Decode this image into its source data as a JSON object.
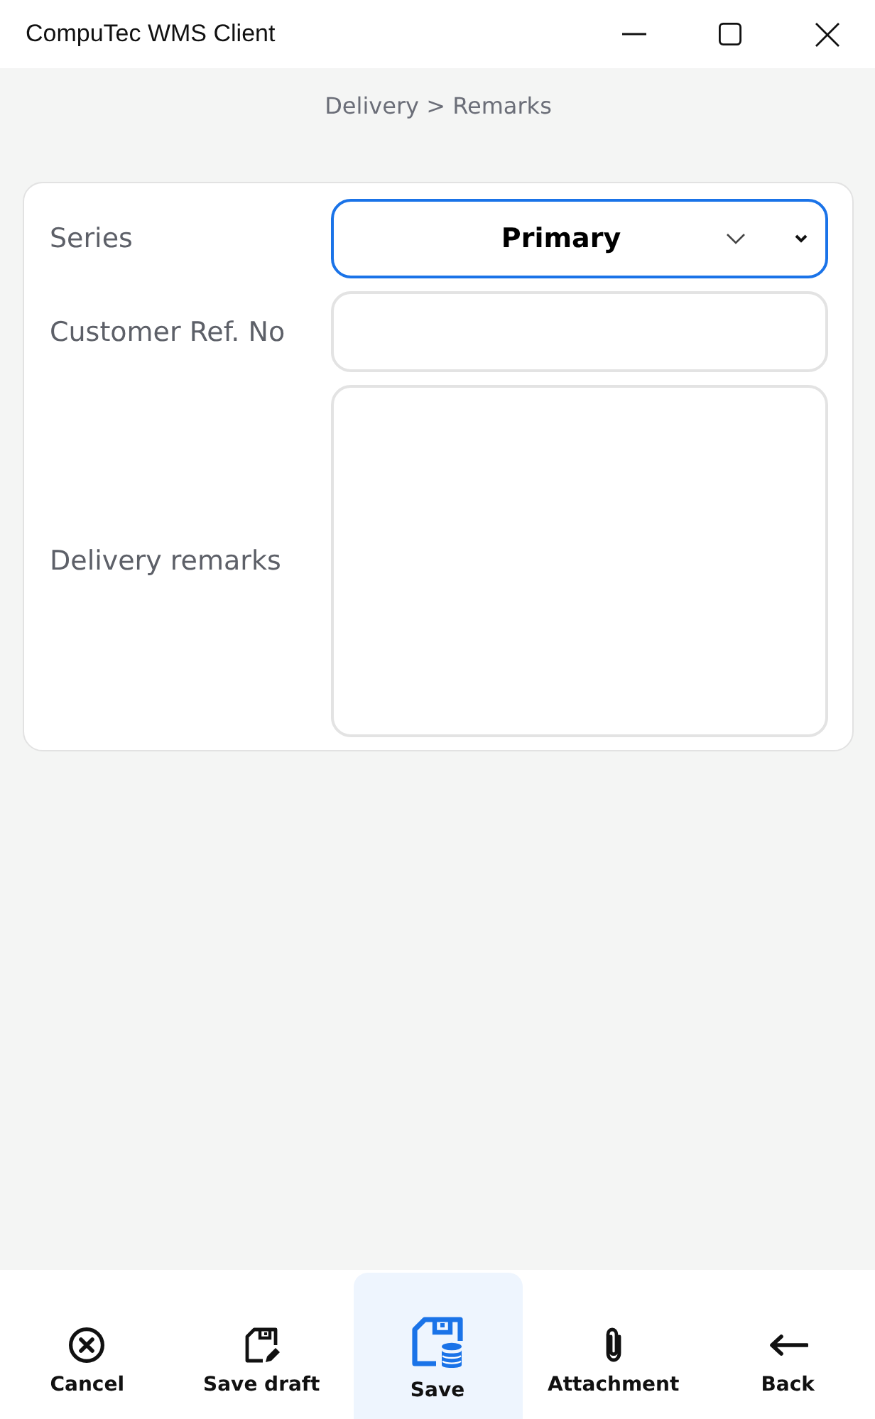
{
  "window": {
    "title": "CompuTec WMS Client"
  },
  "breadcrumb": "Delivery > Remarks",
  "form": {
    "fields": [
      {
        "kind": "select",
        "label": "Series",
        "value": "Primary",
        "focused": true
      },
      {
        "kind": "input",
        "label": "Customer Ref. No",
        "focused": false
      },
      {
        "kind": "textarea",
        "label": "Delivery remarks",
        "focused": false
      }
    ]
  },
  "toolbar": [
    {
      "kind": "cancel",
      "label": "Cancel",
      "selected": false
    },
    {
      "kind": "draft",
      "label": "Save draft",
      "selected": false
    },
    {
      "kind": "save",
      "label": "Save",
      "selected": true
    },
    {
      "kind": "attach",
      "label": "Attachment",
      "selected": false
    },
    {
      "kind": "back",
      "label": "Back",
      "selected": false
    }
  ]
}
